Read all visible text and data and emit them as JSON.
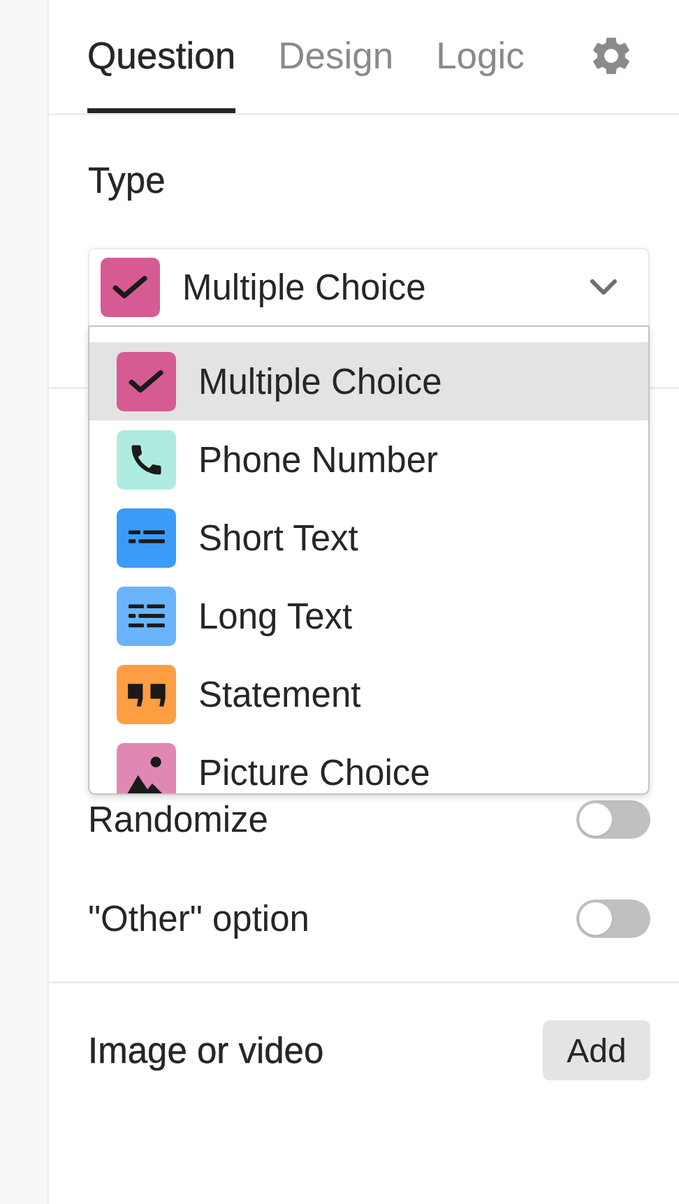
{
  "tabs": [
    {
      "label": "Question",
      "selected": true
    },
    {
      "label": "Design",
      "selected": false
    },
    {
      "label": "Logic",
      "selected": false
    }
  ],
  "type_section": {
    "label": "Type",
    "dropdown": {
      "value": "Multiple Choice",
      "expanded": true
    },
    "options": [
      {
        "label": "Multiple Choice",
        "kind": "check",
        "color": "#d65b93",
        "selected": true
      },
      {
        "label": "Phone Number",
        "kind": "phone",
        "color": "#aeebe1",
        "selected": false
      },
      {
        "label": "Short Text",
        "kind": "short",
        "color": "#3b9cf8",
        "selected": false
      },
      {
        "label": "Long Text",
        "kind": "long",
        "color": "#6ab4fb",
        "selected": false
      },
      {
        "label": "Statement",
        "kind": "quote",
        "color": "#fe9e42",
        "selected": false
      },
      {
        "label": "Picture Choice",
        "kind": "picture",
        "color": "#e088b4",
        "selected": false
      }
    ]
  },
  "toggle_settings": [
    {
      "label": "Randomize",
      "on": false
    },
    {
      "label": "\"Other\" option",
      "on": false
    }
  ],
  "media": {
    "label": "Image or video",
    "button": "Add"
  }
}
